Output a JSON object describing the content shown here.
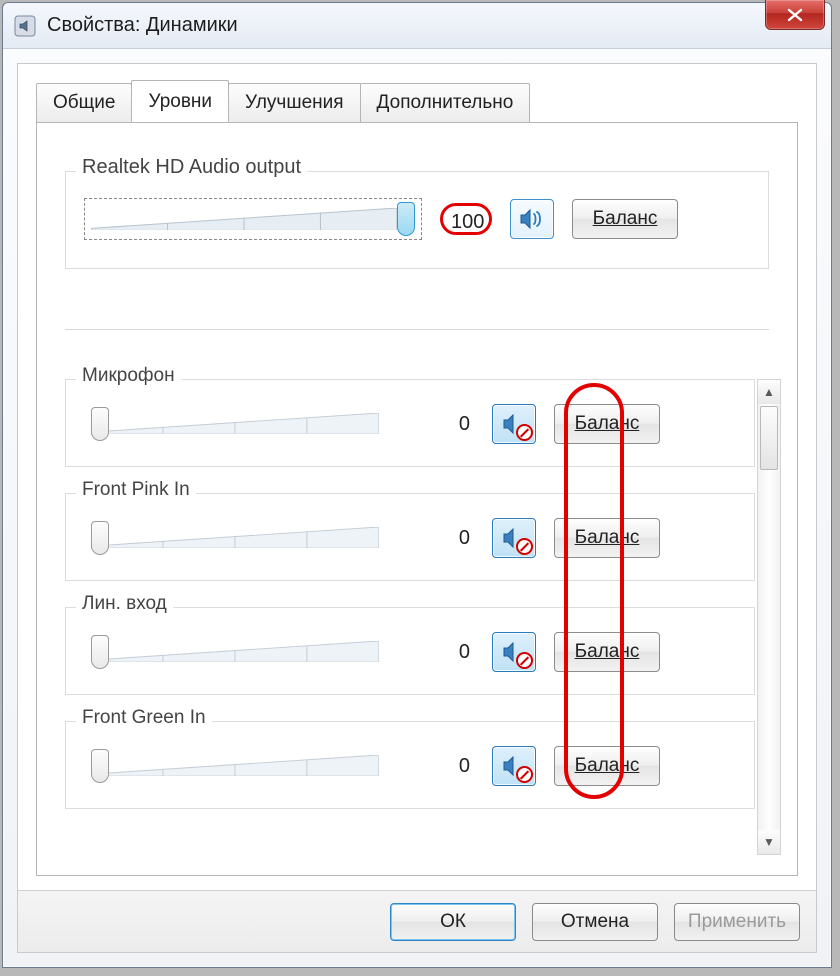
{
  "window": {
    "title": "Свойства: Динамики"
  },
  "tabs": {
    "general": "Общие",
    "levels": "Уровни",
    "enhancements": "Улучшения",
    "advanced": "Дополнительно"
  },
  "main_output": {
    "label": "Realtek HD Audio output",
    "value": "100",
    "slider_percent": 100,
    "muted": false,
    "balance": "Баланс"
  },
  "channels": [
    {
      "label": "Микрофон",
      "value": "0",
      "slider_percent": 0,
      "muted": true,
      "balance": "Баланс"
    },
    {
      "label": "Front Pink In",
      "value": "0",
      "slider_percent": 0,
      "muted": true,
      "balance": "Баланс"
    },
    {
      "label": "Лин. вход",
      "value": "0",
      "slider_percent": 0,
      "muted": true,
      "balance": "Баланс"
    },
    {
      "label": "Front Green In",
      "value": "0",
      "slider_percent": 0,
      "muted": true,
      "balance": "Баланс"
    }
  ],
  "buttons": {
    "ok": "ОК",
    "cancel": "Отмена",
    "apply": "Применить"
  }
}
